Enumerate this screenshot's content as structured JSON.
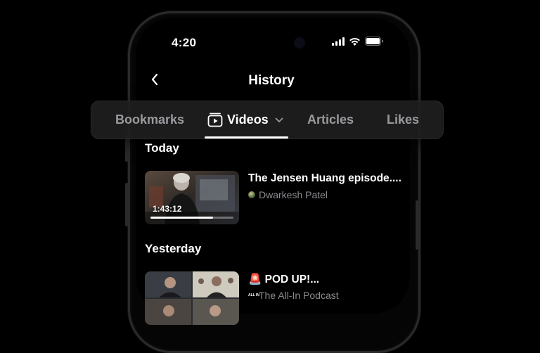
{
  "status_bar": {
    "time": "4:20"
  },
  "header": {
    "title": "History"
  },
  "tabs": {
    "items": [
      {
        "label": "Bookmarks",
        "active": false
      },
      {
        "label": "Videos",
        "active": true,
        "icon": "video-icon",
        "dropdown": true
      },
      {
        "label": "Articles",
        "active": false
      },
      {
        "label": "Likes",
        "active": false
      }
    ]
  },
  "sections": [
    {
      "label": "Today",
      "videos": [
        {
          "title": "The Jensen Huang episode....",
          "channel": "Dwarkesh Patel",
          "duration": "1:43:12",
          "progress": 0.75
        }
      ]
    },
    {
      "label": "Yesterday",
      "videos": [
        {
          "title": "🚨 POD UP!...",
          "channel": "The All-In Podcast",
          "channel_icon_text": "ALL IN"
        }
      ]
    }
  ],
  "colors": {
    "background": "#000000",
    "accent": "#ffffff",
    "muted": "#8b8b90",
    "tabbar": "#1e1e20"
  }
}
